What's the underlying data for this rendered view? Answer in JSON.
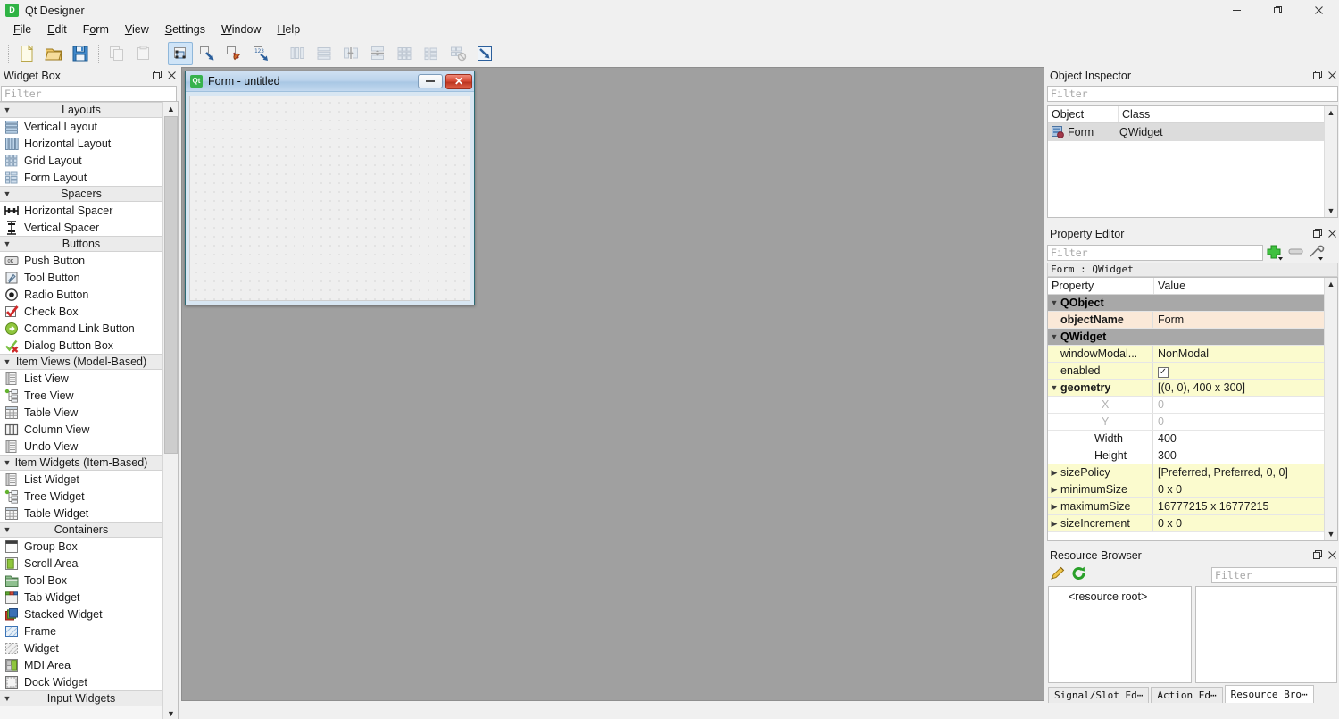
{
  "window": {
    "title": "Qt Designer",
    "logo_text": "D",
    "controls": {
      "minimize": "—",
      "maximize": "❐",
      "close": "✕"
    }
  },
  "menubar": {
    "items": [
      {
        "label": "File",
        "mnemonic": "F"
      },
      {
        "label": "Edit",
        "mnemonic": "E"
      },
      {
        "label": "Form",
        "mnemonic": "o"
      },
      {
        "label": "View",
        "mnemonic": "V"
      },
      {
        "label": "Settings",
        "mnemonic": "S"
      },
      {
        "label": "Window",
        "mnemonic": "W"
      },
      {
        "label": "Help",
        "mnemonic": "H"
      }
    ]
  },
  "toolbar": {
    "groups": [
      [
        {
          "icon": "new-form-icon",
          "label": "New",
          "state": "enabled"
        },
        {
          "icon": "open-form-icon",
          "label": "Open",
          "state": "enabled"
        },
        {
          "icon": "save-form-icon",
          "label": "Save",
          "state": "enabled"
        }
      ],
      [
        {
          "icon": "copy-icon",
          "label": "Copy",
          "state": "disabled"
        },
        {
          "icon": "paste-icon",
          "label": "Paste",
          "state": "disabled"
        }
      ],
      [
        {
          "icon": "edit-widgets-icon",
          "label": "Edit Widgets",
          "state": "active"
        },
        {
          "icon": "edit-signals-slots-icon",
          "label": "Edit Signals/Slots",
          "state": "enabled"
        },
        {
          "icon": "edit-buddies-icon",
          "label": "Edit Buddies",
          "state": "enabled"
        },
        {
          "icon": "edit-tab-order-icon",
          "label": "Edit Tab Order",
          "state": "enabled"
        }
      ],
      [
        {
          "icon": "layout-horizontally-icon",
          "label": "Lay Out Horizontally",
          "state": "disabled"
        },
        {
          "icon": "layout-vertically-icon",
          "label": "Lay Out Vertically",
          "state": "disabled"
        },
        {
          "icon": "layout-splitter-horizontal-icon",
          "label": "Lay Out Horizontally in Splitter",
          "state": "disabled"
        },
        {
          "icon": "layout-splitter-vertical-icon",
          "label": "Lay Out Vertically in Splitter",
          "state": "disabled"
        },
        {
          "icon": "layout-grid-icon",
          "label": "Lay Out in a Grid",
          "state": "disabled"
        },
        {
          "icon": "layout-form-icon",
          "label": "Lay Out in a Form Layout",
          "state": "disabled"
        },
        {
          "icon": "break-layout-icon",
          "label": "Break Layout",
          "state": "disabled"
        },
        {
          "icon": "adjust-size-icon",
          "label": "Adjust Size",
          "state": "enabled"
        }
      ]
    ]
  },
  "widget_box": {
    "title": "Widget Box",
    "filter_placeholder": "Filter",
    "categories": [
      {
        "name": "Layouts",
        "expanded": true,
        "items": [
          {
            "label": "Vertical Layout",
            "icon": "vertical-layout-icon"
          },
          {
            "label": "Horizontal Layout",
            "icon": "horizontal-layout-icon"
          },
          {
            "label": "Grid Layout",
            "icon": "grid-layout-icon"
          },
          {
            "label": "Form Layout",
            "icon": "form-layout-icon"
          }
        ]
      },
      {
        "name": "Spacers",
        "expanded": true,
        "items": [
          {
            "label": "Horizontal Spacer",
            "icon": "horizontal-spacer-icon"
          },
          {
            "label": "Vertical Spacer",
            "icon": "vertical-spacer-icon"
          }
        ]
      },
      {
        "name": "Buttons",
        "expanded": true,
        "items": [
          {
            "label": "Push Button",
            "icon": "push-button-icon"
          },
          {
            "label": "Tool Button",
            "icon": "tool-button-icon"
          },
          {
            "label": "Radio Button",
            "icon": "radio-button-icon"
          },
          {
            "label": "Check Box",
            "icon": "check-box-icon"
          },
          {
            "label": "Command Link Button",
            "icon": "command-link-button-icon"
          },
          {
            "label": "Dialog Button Box",
            "icon": "dialog-button-box-icon"
          }
        ]
      },
      {
        "name": "Item Views (Model-Based)",
        "expanded": true,
        "items": [
          {
            "label": "List View",
            "icon": "list-view-icon"
          },
          {
            "label": "Tree View",
            "icon": "tree-view-icon"
          },
          {
            "label": "Table View",
            "icon": "table-view-icon"
          },
          {
            "label": "Column View",
            "icon": "column-view-icon"
          },
          {
            "label": "Undo View",
            "icon": "undo-view-icon"
          }
        ]
      },
      {
        "name": "Item Widgets (Item-Based)",
        "expanded": true,
        "items": [
          {
            "label": "List Widget",
            "icon": "list-widget-icon"
          },
          {
            "label": "Tree Widget",
            "icon": "tree-widget-icon"
          },
          {
            "label": "Table Widget",
            "icon": "table-widget-icon"
          }
        ]
      },
      {
        "name": "Containers",
        "expanded": true,
        "items": [
          {
            "label": "Group Box",
            "icon": "group-box-icon"
          },
          {
            "label": "Scroll Area",
            "icon": "scroll-area-icon"
          },
          {
            "label": "Tool Box",
            "icon": "tool-box-icon"
          },
          {
            "label": "Tab Widget",
            "icon": "tab-widget-icon"
          },
          {
            "label": "Stacked Widget",
            "icon": "stacked-widget-icon"
          },
          {
            "label": "Frame",
            "icon": "frame-icon"
          },
          {
            "label": "Widget",
            "icon": "widget-icon"
          },
          {
            "label": "MDI Area",
            "icon": "mdi-area-icon"
          },
          {
            "label": "Dock Widget",
            "icon": "dock-widget-icon"
          }
        ]
      },
      {
        "name": "Input Widgets",
        "expanded": false,
        "items": []
      }
    ]
  },
  "form_window": {
    "title": "Form - untitled",
    "app_icon_text": "Qt",
    "minimize_label": "—",
    "close_label": "✕"
  },
  "object_inspector": {
    "title": "Object Inspector",
    "filter_placeholder": "Filter",
    "columns": [
      "Object",
      "Class"
    ],
    "rows": [
      {
        "object": "Form",
        "class": "QWidget",
        "icon": "widget-object-icon",
        "selected": true
      }
    ]
  },
  "property_editor": {
    "title": "Property Editor",
    "filter_placeholder": "Filter",
    "context": "Form : QWidget",
    "add_label": "+",
    "remove_label": "—",
    "configure_label": "configure",
    "columns": [
      "Property",
      "Value"
    ],
    "rows": [
      {
        "kind": "group",
        "property": "QObject",
        "value": "",
        "expander": "v"
      },
      {
        "kind": "highlight",
        "property": "objectName",
        "value": "Form",
        "expander": ""
      },
      {
        "kind": "group",
        "property": "QWidget",
        "value": "",
        "expander": "v"
      },
      {
        "kind": "normal",
        "property": "windowModal...",
        "value": "NonModal",
        "expander": ""
      },
      {
        "kind": "normal",
        "property": "enabled",
        "value": "",
        "checkbox": true,
        "expander": ""
      },
      {
        "kind": "normal",
        "property": "geometry",
        "value": "[(0, 0), 400 x 300]",
        "expander": "v",
        "bold": true
      },
      {
        "kind": "sub",
        "property": "X",
        "value": "0",
        "expander": ""
      },
      {
        "kind": "sub",
        "property": "Y",
        "value": "0",
        "expander": ""
      },
      {
        "kind": "sub2",
        "property": "Width",
        "value": "400",
        "expander": ""
      },
      {
        "kind": "sub2",
        "property": "Height",
        "value": "300",
        "expander": ""
      },
      {
        "kind": "normal",
        "property": "sizePolicy",
        "value": "[Preferred, Preferred, 0, 0]",
        "expander": ">"
      },
      {
        "kind": "normal",
        "property": "minimumSize",
        "value": "0 x 0",
        "expander": ">"
      },
      {
        "kind": "normal",
        "property": "maximumSize",
        "value": "16777215 x 16777215",
        "expander": ">"
      },
      {
        "kind": "normal",
        "property": "sizeIncrement",
        "value": "0 x 0",
        "expander": ">"
      }
    ]
  },
  "resource_browser": {
    "title": "Resource Browser",
    "edit_icon": "pencil-edit-icon",
    "reload_icon": "reload-icon",
    "filter_placeholder": "Filter",
    "tree_root": "<resource root>",
    "tabs": [
      {
        "label": "Signal/Slot Ed⋯",
        "selected": false
      },
      {
        "label": "Action Ed⋯",
        "selected": false
      },
      {
        "label": "Resource Bro⋯",
        "selected": true
      }
    ]
  },
  "dock_controls": {
    "float": "❐",
    "close": "✕"
  },
  "colors": {
    "chrome": "#f0f0f0",
    "workspace": "#a0a0a0",
    "property_group": "#a8a8a8",
    "property_highlight": "#fbe9d8",
    "property_normal": "#fbfbce",
    "selection": "#dcdcdc",
    "accent_green": "#2fb344",
    "form_titlebar": "#bcd4ec"
  }
}
